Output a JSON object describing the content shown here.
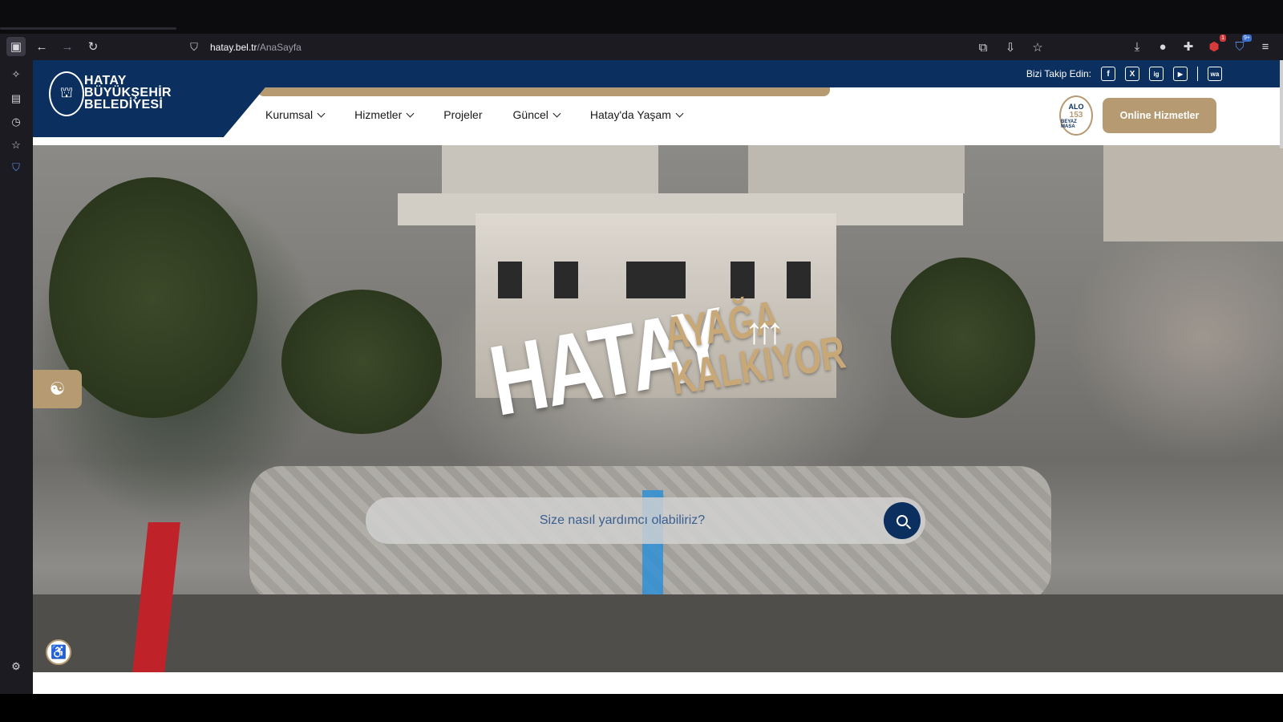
{
  "browser": {
    "url_domain": "hatay.bel.tr",
    "url_path": "/AnaSayfa",
    "toolbar_icons": [
      "sidebar-toggle-icon",
      "back-icon",
      "forward-icon",
      "reload-icon"
    ],
    "right_icons": [
      "picture-in-picture-icon",
      "reader-save-icon",
      "bookmark-star-icon",
      "download-icon",
      "extension-icon",
      "puzzle-icon",
      "ublock-icon",
      "bitwarden-icon",
      "menu-icon"
    ],
    "ublock_badge": "1",
    "bitwarden_badge": "9+",
    "sidebar_icons": [
      "ai-sparkle-icon",
      "synced-tabs-icon",
      "history-icon",
      "bookmarks-icon",
      "shield-icon",
      "settings-icon"
    ]
  },
  "header": {
    "logo_line1": "HATAY",
    "logo_line2": "BÜYÜKŞEHİR",
    "logo_line3": "BELEDİYESİ",
    "follow_label": "Bizi Takip Edin:",
    "social": [
      "f",
      "X",
      "ig",
      "▶",
      "wa"
    ],
    "nav": [
      {
        "label": "Kurumsal",
        "dropdown": true
      },
      {
        "label": "Hizmetler",
        "dropdown": true
      },
      {
        "label": "Projeler",
        "dropdown": false
      },
      {
        "label": "Güncel",
        "dropdown": true
      },
      {
        "label": "Hatay'da Yaşam",
        "dropdown": true
      }
    ],
    "alo_top": "ALO",
    "alo_number": "153",
    "alo_bottom": "BEYAZ MASA",
    "online_button": "Online Hizmetler"
  },
  "hero": {
    "title_main": "HATAY",
    "title_line1": "AYAĞA",
    "title_line2": "KALKIYOR",
    "search_placeholder": "Size nasıl yardımcı olabiliriz?"
  },
  "colors": {
    "navy": "#0b2f5e",
    "gold": "#b59a72",
    "search_text": "#3b5f90"
  }
}
